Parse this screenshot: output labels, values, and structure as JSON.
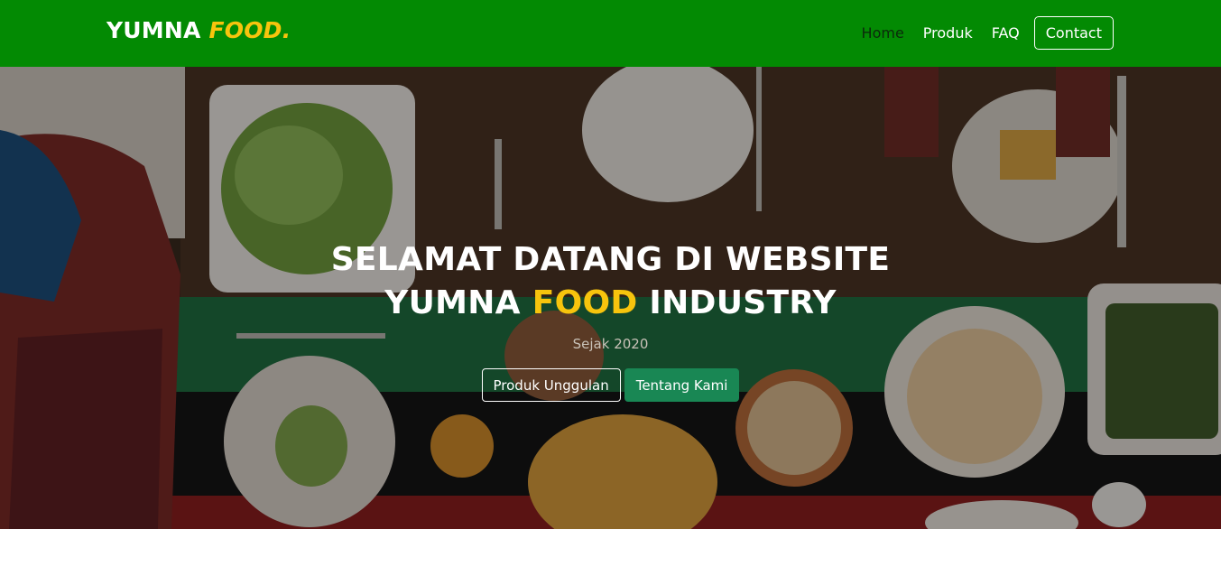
{
  "brand": {
    "name_main": "YUMNA",
    "name_accent": "FOOD."
  },
  "nav": {
    "items": [
      {
        "label": "Home",
        "active": true
      },
      {
        "label": "Produk",
        "active": false
      },
      {
        "label": "FAQ",
        "active": false
      }
    ],
    "contact_label": "Contact"
  },
  "hero": {
    "title_line1": "SELAMAT DATANG DI WEBSITE",
    "title_line2_pre": "YUMNA",
    "title_line2_accent": "FOOD",
    "title_line2_post": "INDUSTRY",
    "subtitle": "Sejak 2020",
    "primary_button": "Produk Unggulan",
    "secondary_button": "Tentang Kami"
  },
  "colors": {
    "navbar": "#038a03",
    "accent": "#f7c40d",
    "button_green": "#198754"
  }
}
